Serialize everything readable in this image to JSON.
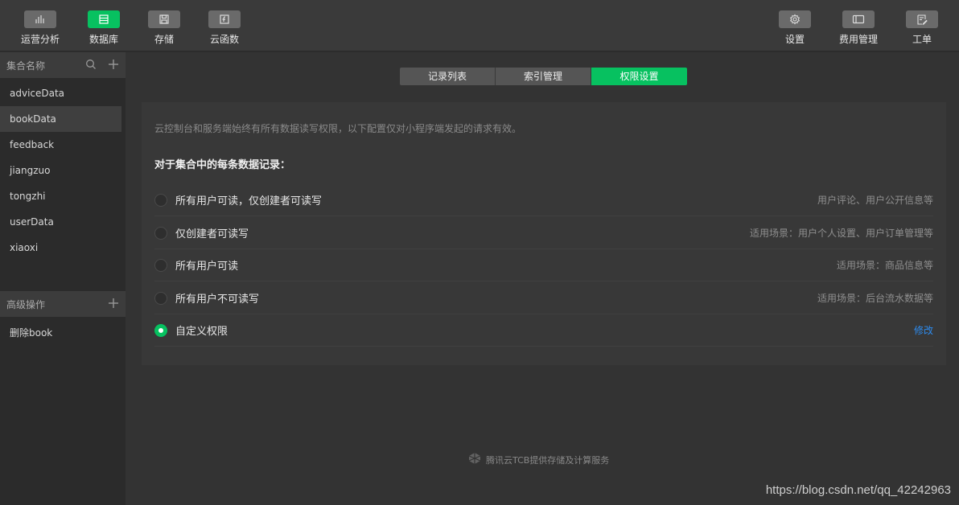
{
  "topnav": {
    "left": [
      {
        "label": "运营分析",
        "icon": "bar-chart-icon"
      },
      {
        "label": "数据库",
        "icon": "database-icon",
        "active": true
      },
      {
        "label": "存储",
        "icon": "storage-icon"
      },
      {
        "label": "云函数",
        "icon": "function-icon"
      }
    ],
    "right": [
      {
        "label": "设置",
        "icon": "gear-icon"
      },
      {
        "label": "费用管理",
        "icon": "billing-icon"
      },
      {
        "label": "工单",
        "icon": "ticket-icon"
      }
    ]
  },
  "sidebar": {
    "collections_header": "集合名称",
    "collections": [
      "adviceData",
      "bookData",
      "feedback",
      "jiangzuo",
      "tongzhi",
      "userData",
      "xiaoxi"
    ],
    "active_collection": "bookData",
    "advanced_header": "高级操作",
    "advanced_items": [
      "删除book"
    ]
  },
  "tabs": [
    "记录列表",
    "索引管理",
    "权限设置"
  ],
  "active_tab": "权限设置",
  "panel": {
    "notice": "云控制台和服务端始终有所有数据读写权限，以下配置仅对小程序端发起的请求有效。",
    "subtitle": "对于集合中的每条数据记录：",
    "options": [
      {
        "label": "所有用户可读，仅创建者可读写",
        "desc": "用户评论、用户公开信息等",
        "checked": false
      },
      {
        "label": "仅创建者可读写",
        "desc": "适用场景：用户个人设置、用户订单管理等",
        "checked": false
      },
      {
        "label": "所有用户可读",
        "desc": "适用场景：商品信息等",
        "checked": false
      },
      {
        "label": "所有用户不可读写",
        "desc": "适用场景：后台流水数据等",
        "checked": false
      },
      {
        "label": "自定义权限",
        "link": "修改",
        "checked": true
      }
    ]
  },
  "footer": "腾讯云TCB提供存储及计算服务",
  "watermark": "https://blog.csdn.net/qq_42242963",
  "colors": {
    "accent": "#07c160",
    "link": "#2d8cf0"
  }
}
